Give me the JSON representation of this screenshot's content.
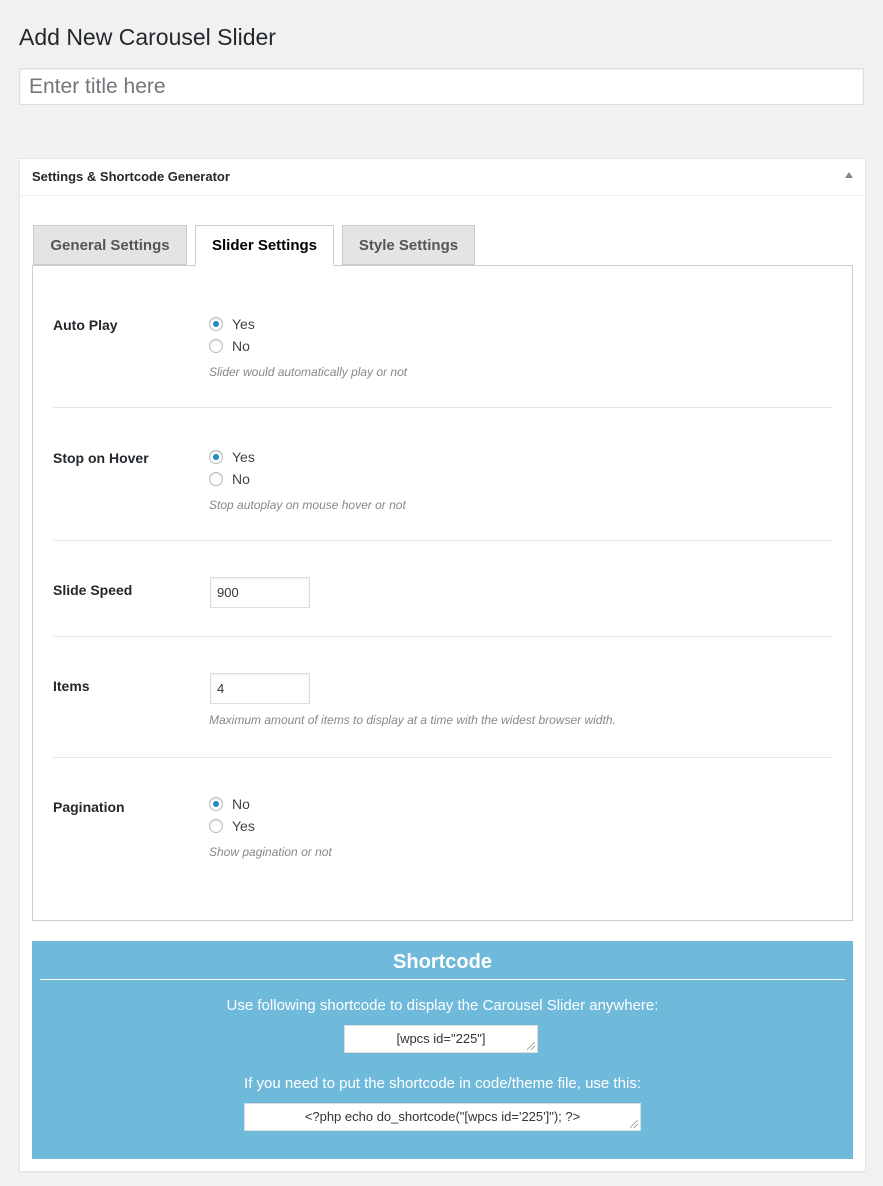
{
  "page": {
    "title": "Add New Carousel Slider",
    "title_placeholder": "Enter title here"
  },
  "metabox": {
    "title": "Settings & Shortcode Generator",
    "toggle_icon": "triangle-up-icon"
  },
  "tabs": [
    {
      "label": "General Settings",
      "active": false
    },
    {
      "label": "Slider Settings",
      "active": true
    },
    {
      "label": "Style Settings",
      "active": false
    }
  ],
  "settings": {
    "auto_play": {
      "label": "Auto Play",
      "options": [
        {
          "label": "Yes",
          "checked": true
        },
        {
          "label": "No",
          "checked": false
        }
      ],
      "description": "Slider would automatically play or not"
    },
    "stop_on_hover": {
      "label": "Stop on Hover",
      "options": [
        {
          "label": "Yes",
          "checked": true
        },
        {
          "label": "No",
          "checked": false
        }
      ],
      "description": "Stop autoplay on mouse hover or not"
    },
    "slide_speed": {
      "label": "Slide Speed",
      "value": "900"
    },
    "items": {
      "label": "Items",
      "value": "4",
      "description": "Maximum amount of items to display at a time with the widest browser width."
    },
    "pagination": {
      "label": "Pagination",
      "options": [
        {
          "label": "No",
          "checked": true
        },
        {
          "label": "Yes",
          "checked": false
        }
      ],
      "description": "Show pagination or not"
    }
  },
  "shortcode": {
    "title": "Shortcode",
    "instruction": "Use following shortcode to display the Carousel Slider anywhere:",
    "code": "[wpcs id=\"225\"]",
    "php_instruction": "If you need to put the shortcode in code/theme file, use this:",
    "php_code": "<?php echo do_shortcode(\"[wpcs id='225']\"); ?>",
    "background_color": "#6fb9db"
  }
}
